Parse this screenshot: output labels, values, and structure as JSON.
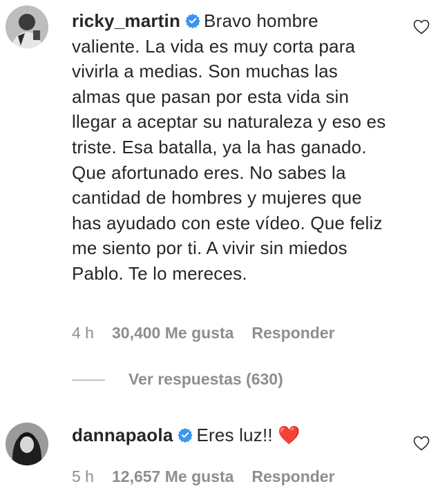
{
  "comments": [
    {
      "username": "ricky_martin",
      "text": "Bravo hombre valiente. La vida es muy corta para vivirla a medias. Son muchas las almas que pasan por esta vida sin llegar a aceptar su naturaleza y eso es triste. Esa batalla, ya la has ganado. Que afortunado eres. No sabes la cantidad de hombres y mujeres que has ayudado con este vídeo. Que feliz me siento por ti. A vivir sin miedos Pablo. Te lo mereces.",
      "time": "4 h",
      "likes": "30,400 Me gusta",
      "reply_label": "Responder",
      "view_replies": "Ver respuestas (630)"
    },
    {
      "username": "dannapaola",
      "text": "Eres luz!!",
      "emoji": "❤️",
      "time": "5 h",
      "likes": "12,657 Me gusta",
      "reply_label": "Responder"
    }
  ],
  "colors": {
    "text": "#262626",
    "secondary": "#8e8e8e",
    "verified": "#3897f0"
  },
  "icons": [
    "verified-badge-icon",
    "heart-outline-icon"
  ]
}
